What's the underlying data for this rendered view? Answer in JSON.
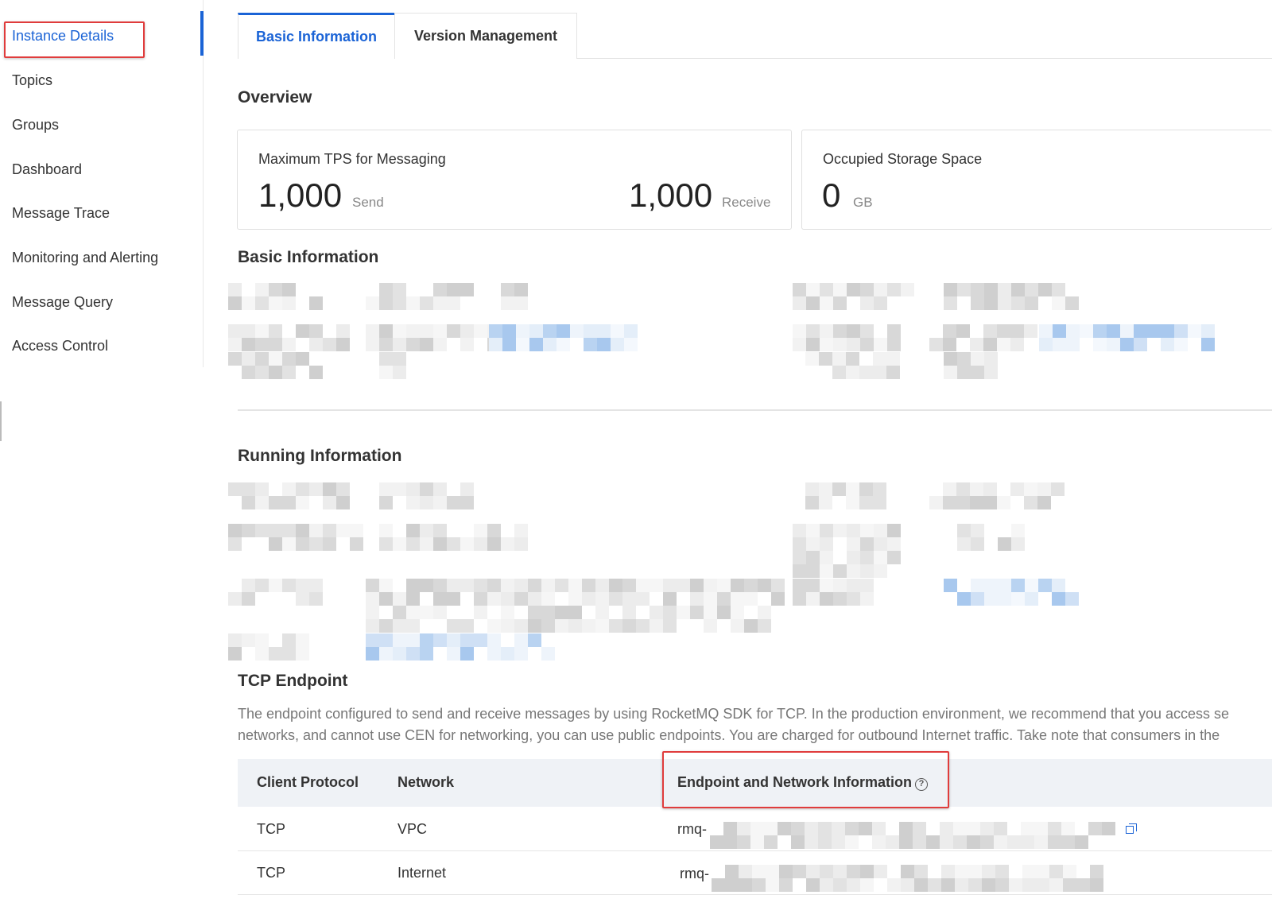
{
  "sidebar": {
    "items": [
      {
        "label": "Instance Details",
        "active": true
      },
      {
        "label": "Topics"
      },
      {
        "label": "Groups"
      },
      {
        "label": "Dashboard"
      },
      {
        "label": "Message Trace"
      },
      {
        "label": "Monitoring and Alerting"
      },
      {
        "label": "Message Query"
      },
      {
        "label": "Access Control"
      }
    ]
  },
  "tabs": [
    {
      "label": "Basic Information",
      "active": true
    },
    {
      "label": "Version Management"
    }
  ],
  "overview": {
    "title": "Overview",
    "tps_card": {
      "label": "Maximum TPS for Messaging",
      "send_value": "1,000",
      "send_unit": "Send",
      "receive_value": "1,000",
      "receive_unit": "Receive"
    },
    "storage_card": {
      "label": "Occupied Storage Space",
      "value": "0",
      "unit": "GB"
    }
  },
  "basic_information": {
    "title": "Basic Information"
  },
  "running_information": {
    "title": "Running Information"
  },
  "tcp_endpoint": {
    "title": "TCP Endpoint",
    "description_line1": "The endpoint configured to send and receive messages by using RocketMQ SDK for TCP. In the production environment, we recommend that you access se",
    "description_line2": "networks, and cannot use CEN for networking, you can use public endpoints. You are charged for outbound Internet traffic. Take note that consumers in the",
    "columns": [
      "Client Protocol",
      "Network",
      "Endpoint and Network Information"
    ],
    "rows": [
      {
        "protocol": "TCP",
        "network": "VPC",
        "endpoint_prefix": "rmq-"
      },
      {
        "protocol": "TCP",
        "network": "Internet",
        "endpoint_prefix": "rmq-"
      }
    ]
  },
  "colors": {
    "accent": "#1a63d6",
    "highlight_box": "#e03c3c",
    "table_header_bg": "#eff2f6"
  },
  "icons": {
    "help": "question-circle-icon",
    "copy": "copy-icon"
  }
}
